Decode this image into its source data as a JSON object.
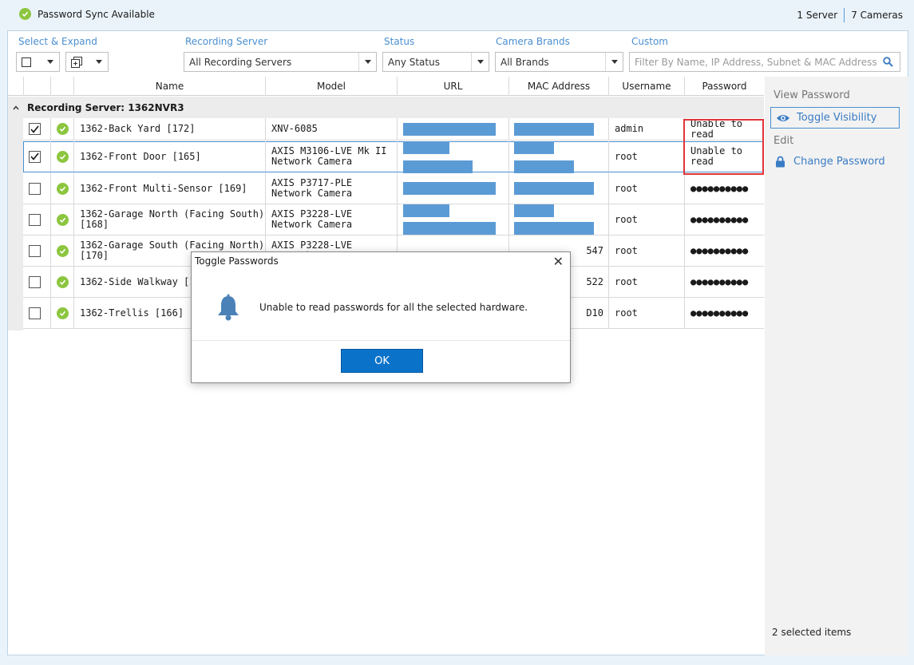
{
  "topbar": {
    "sync_label": "Password Sync Available",
    "servers": "1 Server",
    "cameras": "7 Cameras"
  },
  "filters": {
    "select_expand_label": "Select & Expand",
    "recording_server_label": "Recording Server",
    "recording_server_value": "All Recording Servers",
    "status_label": "Status",
    "status_value": "Any Status",
    "camera_brands_label": "Camera Brands",
    "camera_brands_value": "All Brands",
    "custom_label": "Custom",
    "custom_placeholder": "Filter By Name, IP Address, Subnet & MAC Address"
  },
  "table": {
    "columns": [
      "Name",
      "Model",
      "URL",
      "MAC Address",
      "Username",
      "Password"
    ],
    "group_label": "Recording Server: 1362NVR3",
    "rows": [
      {
        "name": "1362-Back Yard [172]",
        "model": "XNV-6085",
        "username": "admin",
        "password": "Unable to read",
        "checked": true
      },
      {
        "name": "1362-Front Door [165]",
        "model": "AXIS M3106-LVE Mk II Network Camera",
        "username": "root",
        "password": "Unable to read",
        "checked": true
      },
      {
        "name": "1362-Front Multi-Sensor [169]",
        "model": "AXIS P3717-PLE Network Camera",
        "username": "root",
        "password": "●●●●●●●●●●",
        "checked": false
      },
      {
        "name": "1362-Garage North (Facing South) [168]",
        "model": "AXIS P3228-LVE Network Camera",
        "username": "root",
        "password": "●●●●●●●●●●",
        "checked": false
      },
      {
        "name": "1362-Garage South (Facing North) [170]",
        "model": "AXIS P3228-LVE Network",
        "mac_tail": "547",
        "username": "root",
        "password": "●●●●●●●●●●",
        "checked": false
      },
      {
        "name": "1362-Side Walkway [167",
        "model": "",
        "mac_tail": "522",
        "username": "root",
        "password": "●●●●●●●●●●",
        "checked": false
      },
      {
        "name": "1362-Trellis [166]",
        "model": "",
        "mac_tail": "D10",
        "username": "root",
        "password": "●●●●●●●●●●",
        "checked": false
      }
    ]
  },
  "side": {
    "view_password_label": "View Password",
    "toggle_visibility_label": "Toggle Visibility",
    "edit_label": "Edit",
    "change_password_label": "Change Password",
    "selected_count": "2 selected items"
  },
  "dialog": {
    "title": "Toggle Passwords",
    "close_glyph": "✕",
    "message": "Unable to read passwords for all the selected hardware.",
    "ok_label": "OK"
  },
  "colors": {
    "accent": "#4a8fd0",
    "ok_green": "#8cc63f",
    "highlight_red": "#e0343a",
    "button_blue": "#0a73c9"
  }
}
